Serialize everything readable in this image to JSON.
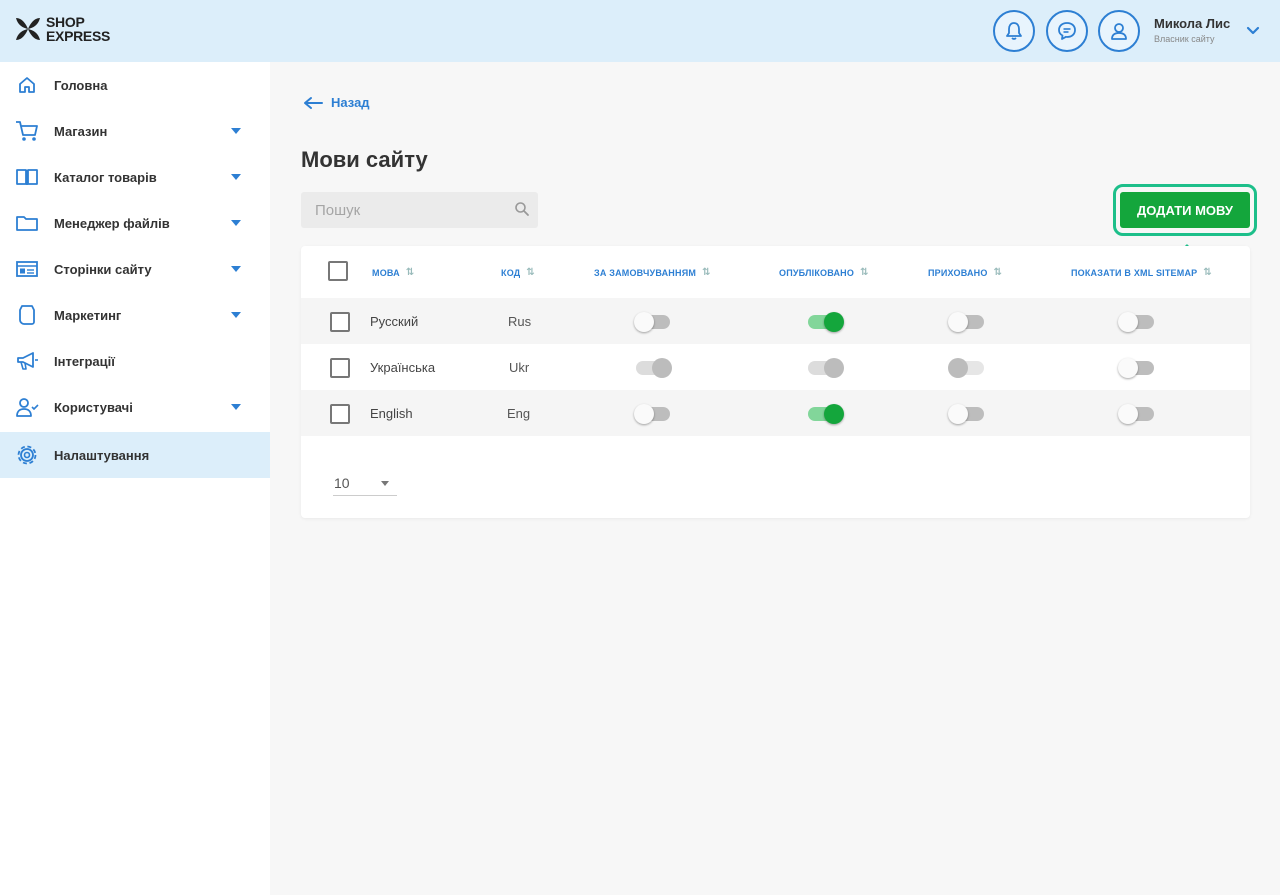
{
  "brand": {
    "line1": "SHOP",
    "line2": "EXPRESS"
  },
  "header": {
    "icons": [
      "bell-icon",
      "chat-icon",
      "user-icon"
    ],
    "user_name": "Микола Лис",
    "user_role": "Власник сайту"
  },
  "sidebar": {
    "items": [
      {
        "label": "Головна",
        "icon": "home-icon",
        "expandable": false,
        "active": false
      },
      {
        "label": "Магазин",
        "icon": "cart-icon",
        "expandable": true,
        "active": false
      },
      {
        "label": "Каталог товарів",
        "icon": "catalog-book-icon",
        "expandable": true,
        "active": false
      },
      {
        "label": "Менеджер файлів",
        "icon": "folder-icon",
        "expandable": true,
        "active": false
      },
      {
        "label": "Сторінки сайту",
        "icon": "page-layout-icon",
        "expandable": true,
        "active": false
      },
      {
        "label": "Маркетинг",
        "icon": "marketing-tag-icon",
        "expandable": true,
        "active": false
      },
      {
        "label": "Інтеграції",
        "icon": "megaphone-icon",
        "expandable": false,
        "active": false
      },
      {
        "label": "Користувачі",
        "icon": "users-icon",
        "expandable": true,
        "active": false
      },
      {
        "label": "Налаштування",
        "icon": "settings-gear-icon",
        "expandable": false,
        "active": true
      }
    ]
  },
  "main": {
    "back_label": "Назад",
    "title": "Мови сайту",
    "search_placeholder": "Пошук",
    "add_button": "ДОДАТИ МОВУ"
  },
  "table": {
    "columns": [
      "МОВА",
      "КОД",
      "ЗА ЗАМОВЧУВАННЯМ",
      "ОПУБЛІКОВАНО",
      "ПРИХОВАНО",
      "ПОКАЗАТИ В XML SITEMAP"
    ],
    "rows": [
      {
        "language": "Русский",
        "code": "Rus",
        "default": "off",
        "published": "on",
        "hidden": "off",
        "sitemap": "off"
      },
      {
        "language": "Українська",
        "code": "Ukr",
        "default": "disabled-on",
        "published": "disabled-on",
        "hidden": "disabled-off",
        "sitemap": "off"
      },
      {
        "language": "English",
        "code": "Eng",
        "default": "off",
        "published": "on",
        "hidden": "off",
        "sitemap": "off"
      }
    ],
    "page_size": "10"
  },
  "colors": {
    "accent": "#2d7fd3",
    "primary_button": "#14a63c",
    "highlight": "#1dbf8a",
    "header_bg": "#dceefa"
  }
}
